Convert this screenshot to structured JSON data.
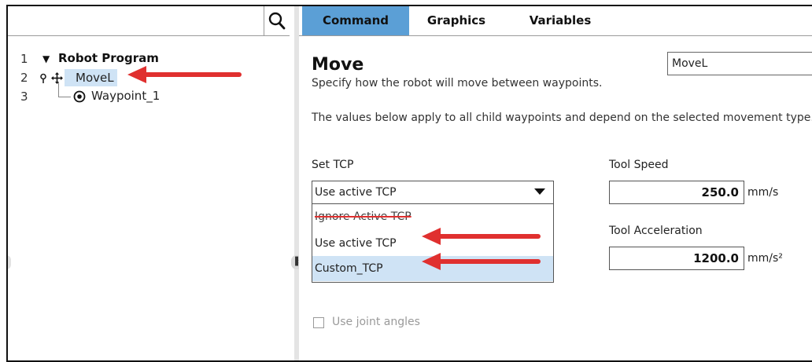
{
  "search": {
    "placeholder": "",
    "icon": "search-icon"
  },
  "tree": {
    "rows": [
      {
        "num": "1",
        "label": "Robot Program",
        "icon": "triangle-down-icon"
      },
      {
        "num": "2",
        "label": "MoveL",
        "icon": "move-icon"
      },
      {
        "num": "3",
        "label": "Waypoint_1",
        "icon": "waypoint-icon"
      }
    ]
  },
  "tabs": [
    {
      "label": "Command",
      "active": true
    },
    {
      "label": "Graphics",
      "active": false
    },
    {
      "label": "Variables",
      "active": false
    }
  ],
  "move": {
    "title": "Move",
    "type_selected": "MoveL",
    "description": "Specify how the robot will move between waypoints.",
    "values_note": "The values below apply to all child waypoints and depend on the selected movement type."
  },
  "tcp": {
    "label": "Set TCP",
    "selected": "Use active TCP",
    "options": [
      "Ignore Active TCP",
      "Use active TCP",
      "Custom_TCP"
    ]
  },
  "speed": {
    "label": "Tool Speed",
    "value": "250.0",
    "unit": "mm/s"
  },
  "accel": {
    "label": "Tool Acceleration",
    "value": "1200.0",
    "unit": "mm/s²"
  },
  "joint_angles": {
    "label": "Use joint angles",
    "checked": false
  },
  "colors": {
    "active_tab": "#5b9fd6",
    "selection": "#cfe3f5",
    "annotation_arrow": "#e0302f",
    "strikethrough": "#e0302f"
  }
}
